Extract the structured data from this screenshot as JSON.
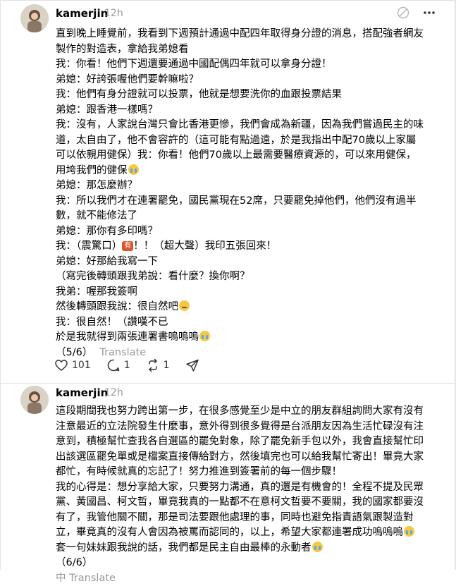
{
  "colors": {
    "muted": "#999999",
    "divider": "#e3e3e3"
  },
  "posts": [
    {
      "username": "kamerjin",
      "time": "12h",
      "icons": [
        "sparkle-off-icon",
        "more-icon"
      ],
      "lines": [
        "直到晚上睡覺前，我看到下週預計通過中配四年取得身分證的消息，搭配強者網友",
        "製作的對造表，拿給我弟媳看",
        "我：你看！他們下週還要通過中國配偶四年就可以拿身分證！",
        "弟媳：好誇張喔他們要幹嘛啦？",
        "我：他們有身分證就可以投票，他就是想要洗你的血跟投票結果",
        "弟媳：跟香港一樣嗎？",
        "我：沒有，人家說台灣只會比香港更慘，我們會成為新疆，因為我們嘗過民主的味",
        "道，太自由了，他不會容許的（這可能有點過遠，於是我指出中配70歲以上家屬",
        "可以依親用健保）我：你看！他們70歲以上最需要醫療資源的，可以來用健保，",
        "用垮我們的健保",
        "弟媳：那怎麼辦？",
        "我：所以我們才在連署罷免，國民黨現在52席，只要罷免掉他們，他們沒有過半",
        "數，就不能修法了",
        "弟媳：那你有多印嗎？",
        "我：（震驚口）",
        "弟媳：好那給我寫一下",
        "（寫完後轉頭跟我弟說：看什麼？換你啊？",
        "我弟：喔那我簽啊",
        "然後轉頭跟我說：很自然吧",
        "我：很自然！（讚嘆不已",
        "於是我就得到兩張連署書嗚嗚嗚",
        "（5/6）"
      ],
      "tag_text": "有",
      "line15_rest": "！！（超大聲）我印五張回來！",
      "translate": "Translate",
      "likes": "101",
      "replies": "1",
      "reposts": "1"
    },
    {
      "username": "kamerjin",
      "time": "12h",
      "lines": [
        "這段期間我也努力跨出第一步，在很多感覺至少是中立的朋友群組詢問大家有沒有",
        "注意最近的立法院發生什麼事，意外得到很多覺得是台派朋友因為生活忙碌沒有注",
        "意到，積極幫忙查我各自選區的罷免對象，除了罷免新手包以外，我會直接幫忙印",
        "出該選區罷免單或是檔案直接傳給對方，然後填完也可以給我幫忙寄出！畢竟大家",
        "都忙，有時候就真的忘記了！努力推進到簽署前的每一個步驟！",
        "我的心得是：想分享給大家，只要努力溝通，真的還是有機會的！全程不提及民眾",
        "黨、黃國昌、柯文哲，畢竟我真的一點都不在意柯文哲要不要關，我的國家都要沒",
        "有了，我管他關不關，那是司法要跟他處理的事，同時也避免指責語氣跟製造對",
        "立，畢竟真的沒有人會因為被罵而認同的，以上，希望大家都連署成功嗚嗚嗚",
        "套一句妹妹跟我說的話，我們都是民主自由最棒的永動者",
        "（6/6）",
        "中 Translate"
      ]
    }
  ]
}
